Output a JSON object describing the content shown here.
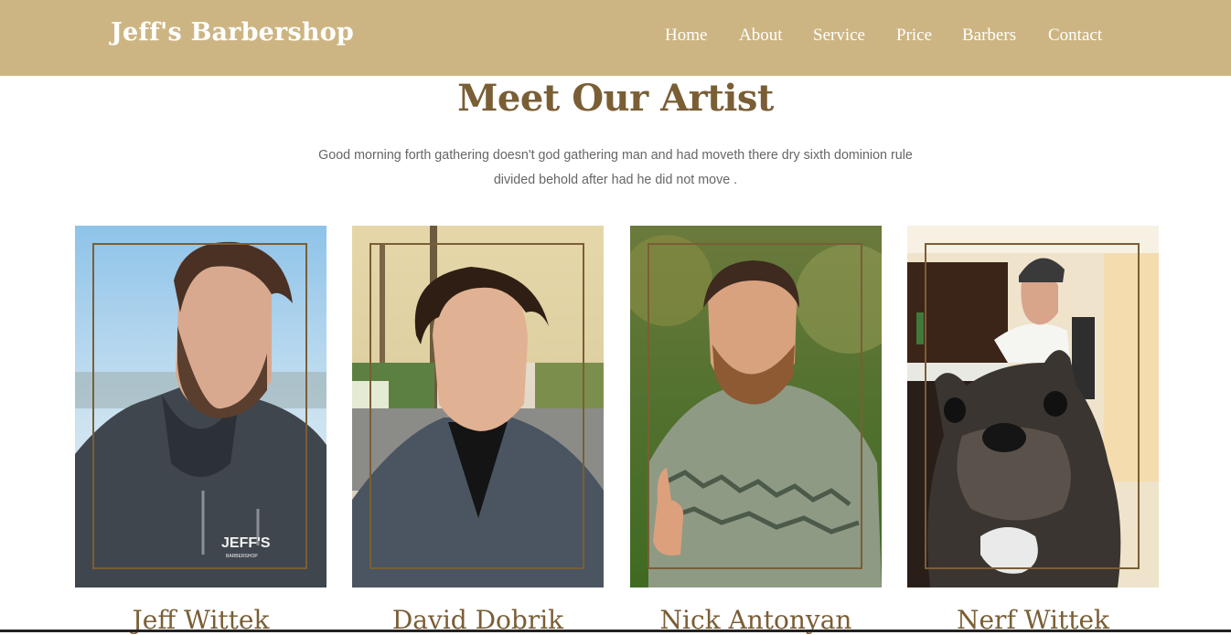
{
  "header": {
    "brand": "Jeff's Barbershop",
    "nav": [
      "Home",
      "About",
      "Service",
      "Price",
      "Barbers",
      "Contact"
    ]
  },
  "section": {
    "title": "Meet Our Artist",
    "description": "Good morning forth gathering doesn't god gathering man and had moveth there dry sixth dominion rule divided behold after had he did not move ."
  },
  "barbers": [
    {
      "name": "Jeff Wittek",
      "hoodie_logo": "JEFF'S",
      "hoodie_sub": "BARBERSHOP"
    },
    {
      "name": "David Dobrik"
    },
    {
      "name": "Nick Antonyan"
    },
    {
      "name": "Nerf Wittek"
    }
  ],
  "colors": {
    "header_bg": "#cdb583",
    "accent": "#7a5e35",
    "text_muted": "#666666"
  }
}
